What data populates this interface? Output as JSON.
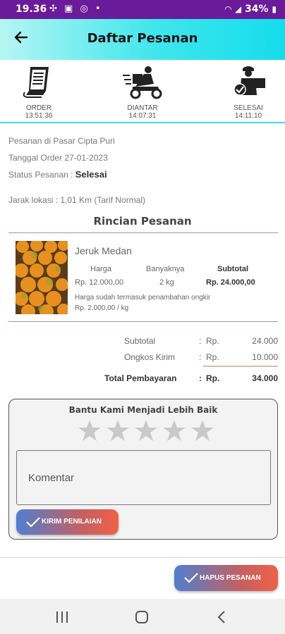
{
  "status_bar": {
    "time": "19.36",
    "battery": "34%"
  },
  "header": {
    "title": "Daftar Pesanan"
  },
  "steps": [
    {
      "label": "ORDER",
      "time": "13:51:36",
      "icon": "receipt-icon"
    },
    {
      "label": "DIANTAR",
      "time": "14:07:31",
      "icon": "delivery-scooter-icon"
    },
    {
      "label": "SELESAI",
      "time": "14:11:10",
      "icon": "delivered-courier-icon"
    }
  ],
  "order": {
    "market": "Pesanan di  Pasar Cipta Puri",
    "date_label": "Tanggal Order",
    "date": "27-01-2023",
    "status_label": "Status Pesanan :",
    "status": "Selesai",
    "distance": "Jarak lokasi :  1,01  Km    (Tarif Normal)"
  },
  "details": {
    "title": "Rincian Pesanan",
    "product_name": "Jeruk Medan",
    "headers": {
      "price": "Harga",
      "qty": "Banyaknya",
      "subtotal": "Subtotal"
    },
    "price": "Rp. 12.000,00",
    "qty": "2  kg",
    "subtotal": "Rp. 24.000,00",
    "note1": "Harga sudah termasuk penambahan ongkir",
    "note2": "Rp. 2.000,00 / kg"
  },
  "totals": {
    "subtotal_label": "Subtotal",
    "shipping_label": "Ongkos Kirim",
    "total_label": "Total Pembayaran",
    "colon": ":",
    "currency": "Rp.",
    "subtotal": "24.000",
    "shipping": "10.000",
    "total": "34.000"
  },
  "rating": {
    "title": "Bantu Kami Menjadi Lebih Baik",
    "stars_total": 5,
    "stars_selected": 0,
    "comment_placeholder": "Komentar",
    "submit_label": "KIRIM PENILAIAN"
  },
  "delete_label": "HAPUS PESANAN",
  "colors": {
    "status_bar": "#6a1b9a",
    "accent": "#3ee6ec",
    "button_start": "#4e7fd0",
    "button_end": "#ef6148"
  }
}
